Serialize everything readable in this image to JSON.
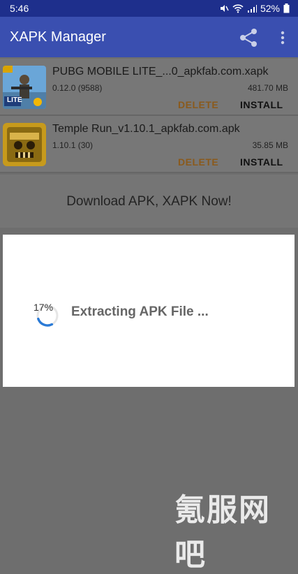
{
  "status": {
    "time": "5:46",
    "battery": "52%"
  },
  "appbar": {
    "title": "XAPK Manager"
  },
  "items": [
    {
      "name": "PUBG MOBILE LITE_...0_apkfab.com.xapk",
      "version": "0.12.0 (9588)",
      "size": "481.70 MB",
      "delete_label": "DELETE",
      "install_label": "INSTALL",
      "badge": "LITE"
    },
    {
      "name": "Temple Run_v1.10.1_apkfab.com.apk",
      "version": "1.10.1 (30)",
      "size": "35.85 MB",
      "delete_label": "DELETE",
      "install_label": "INSTALL"
    }
  ],
  "download_cta": "Download APK, XAPK Now!",
  "dialog": {
    "progress_label": "17%",
    "progress_value": 17,
    "message": "Extracting APK File ..."
  },
  "watermark": "氪服网吧",
  "colors": {
    "statusbar": "#1e2f8c",
    "appbar": "#3a4fb0",
    "delete": "#8a5a1c",
    "spinner": "#2a7ad6"
  }
}
